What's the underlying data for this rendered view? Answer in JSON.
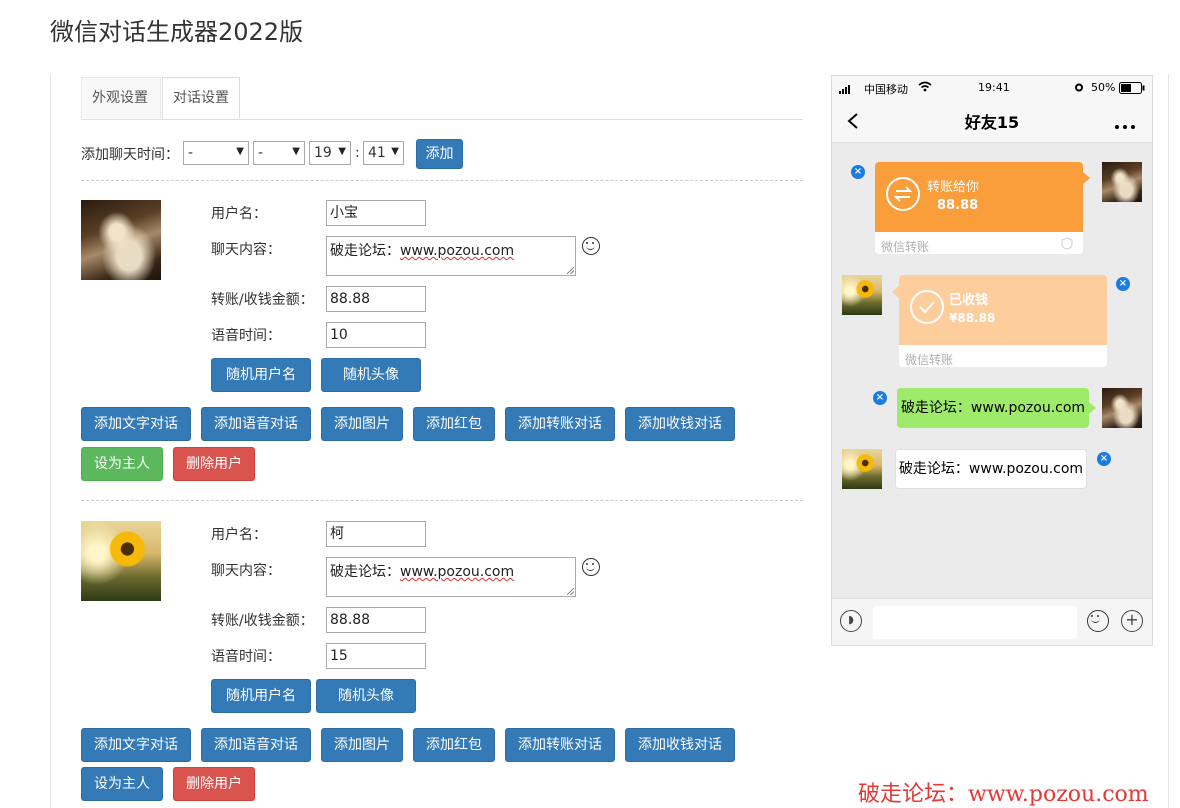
{
  "page": {
    "title": "微信对话生成器2022版"
  },
  "tabs": [
    {
      "label": "外观设置"
    },
    {
      "label": "对话设置"
    }
  ],
  "time_row": {
    "label": "添加聊天时间：",
    "selects": [
      "-",
      "-",
      "19",
      "41"
    ],
    "colon": ":",
    "add_label": "添加"
  },
  "user_form": {
    "username_label": "用户名：",
    "content_label": "聊天内容：",
    "amount_label": "转账/收钱金额：",
    "voice_label": "语音时间：",
    "random_name_label": "随机用户名",
    "random_avatar_label": "随机头像",
    "set_owner_label": "设为主人",
    "delete_user_label": "删除用户",
    "actions": [
      "添加文字对话",
      "添加语音对话",
      "添加图片",
      "添加红包",
      "添加转账对话",
      "添加收钱对话"
    ]
  },
  "users": [
    {
      "name": "小宝",
      "content_prefix": "破走论坛：",
      "content_url": "www.pozou.com",
      "amount": "88.88",
      "voice": "10",
      "avatar": "bride-photo"
    },
    {
      "name": "柯",
      "content_prefix": "破走论坛：",
      "content_url": "www.pozou.com",
      "amount": "88.88",
      "voice": "15",
      "avatar": "sunflower-photo"
    }
  ],
  "phone": {
    "carrier": "中国移动",
    "time": "19:41",
    "battery": "50%",
    "chat_title": "好友15",
    "messages": {
      "transfer_sent": {
        "title": "转账给你",
        "amount": "88.88",
        "footer": "微信转账"
      },
      "transfer_received": {
        "title": "已收钱",
        "amount": "¥88.88",
        "footer": "微信转账"
      },
      "text_right": "破走论坛：www.pozou.com",
      "text_left": "破走论坛：www.pozou.com"
    }
  },
  "watermark": "破走论坛：www.pozou.com",
  "colors": {
    "primary": "#337ab7",
    "success": "#5cb85c",
    "danger": "#d9534f",
    "transfer_orange": "#fa9d3b",
    "received_orange": "#fdcd9b",
    "wechat_green": "#9eea6a"
  }
}
